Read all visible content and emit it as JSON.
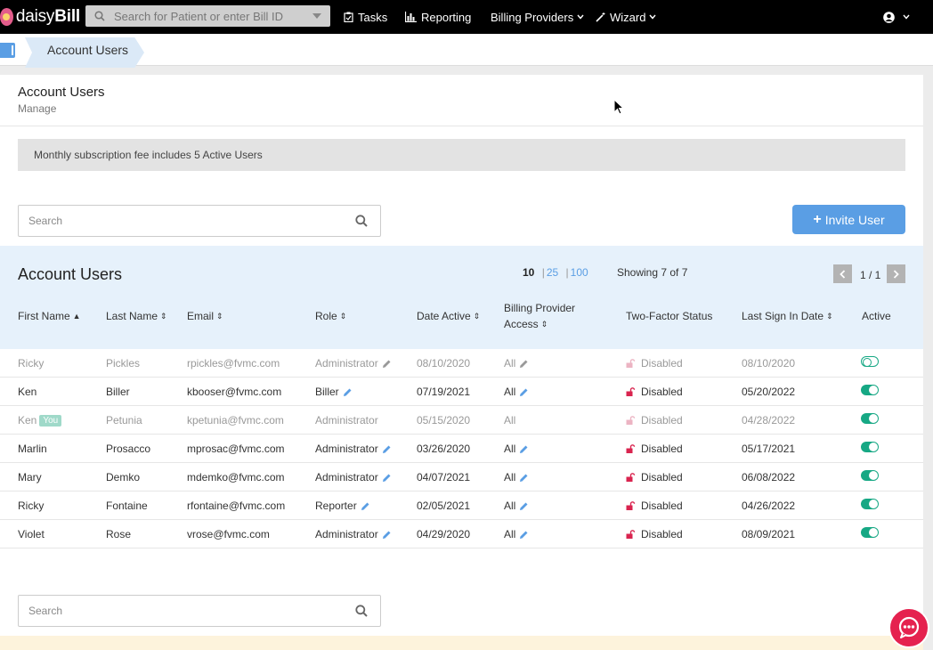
{
  "topnav": {
    "logo_text": "daisyBill",
    "search_placeholder": "Search for Patient or enter Bill ID",
    "tasks": "Tasks",
    "reporting": "Reporting",
    "billing_providers": "Billing Providers",
    "wizard": "Wizard"
  },
  "breadcrumb": {
    "current": "Account Users"
  },
  "page": {
    "title": "Account Users",
    "subtitle": "Manage"
  },
  "notice": "Monthly subscription fee includes 5 Active Users",
  "search": {
    "placeholder": "Search"
  },
  "invite_button": "Invite User",
  "table": {
    "title": "Account Users",
    "page_sizes": {
      "current": "10",
      "opt1": "25",
      "opt2": "100",
      "sep": "|"
    },
    "showing": "Showing 7 of 7",
    "page_indicator": "1 / 1",
    "columns": {
      "first_name": "First Name",
      "last_name": "Last Name",
      "email": "Email",
      "role": "Role",
      "date_active": "Date Active",
      "billing_access_1": "Billing Provider",
      "billing_access_2": "Access",
      "two_factor": "Two-Factor Status",
      "last_sign_in": "Last Sign In Date",
      "active": "Active"
    },
    "you_badge": "You",
    "rows": [
      {
        "first": "Ricky",
        "last": "Pickles",
        "email": "rpickles@fvmc.com",
        "role": "Administrator",
        "date_active": "08/10/2020",
        "access": "All",
        "two_factor": "Disabled",
        "last_sign_in": "08/10/2020"
      },
      {
        "first": "Ken",
        "last": "Biller",
        "email": "kbooser@fvmc.com",
        "role": "Biller",
        "date_active": "07/19/2021",
        "access": "All",
        "two_factor": "Disabled",
        "last_sign_in": "05/20/2022"
      },
      {
        "first": "Ken",
        "last": "Petunia",
        "email": "kpetunia@fvmc.com",
        "role": "Administrator",
        "date_active": "05/15/2020",
        "access": "All",
        "two_factor": "Disabled",
        "last_sign_in": "04/28/2022"
      },
      {
        "first": "Marlin",
        "last": "Prosacco",
        "email": "mprosac@fvmc.com",
        "role": "Administrator",
        "date_active": "03/26/2020",
        "access": "All",
        "two_factor": "Disabled",
        "last_sign_in": "05/17/2021"
      },
      {
        "first": "Mary",
        "last": "Demko",
        "email": "mdemko@fvmc.com",
        "role": "Administrator",
        "date_active": "04/07/2021",
        "access": "All",
        "two_factor": "Disabled",
        "last_sign_in": "06/08/2022"
      },
      {
        "first": "Ricky",
        "last": "Fontaine",
        "email": "rfontaine@fvmc.com",
        "role": "Reporter",
        "date_active": "02/05/2021",
        "access": "All",
        "two_factor": "Disabled",
        "last_sign_in": "04/26/2022"
      },
      {
        "first": "Violet",
        "last": "Rose",
        "email": "vrose@fvmc.com",
        "role": "Administrator",
        "date_active": "04/29/2020",
        "access": "All",
        "two_factor": "Disabled",
        "last_sign_in": "08/09/2021"
      }
    ]
  },
  "colors": {
    "accent": "#5a9ee4",
    "toggle_on": "#16a884",
    "lock": "#d9244f",
    "chat": "#e5224f"
  }
}
